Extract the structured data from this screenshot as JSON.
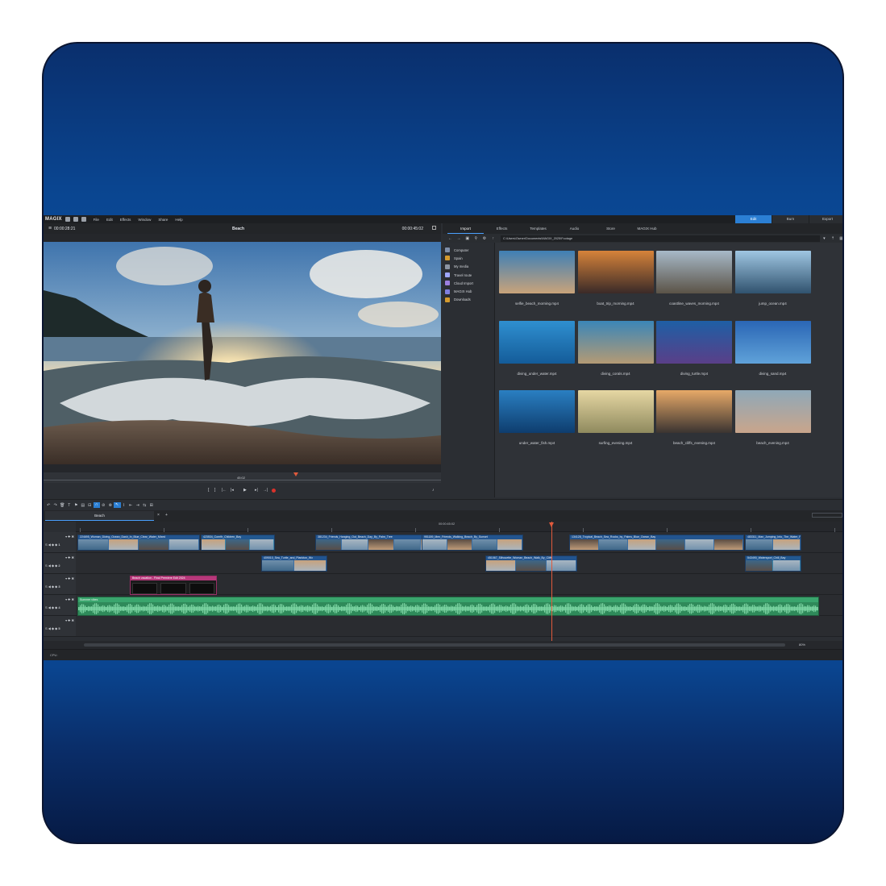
{
  "app": {
    "logo": "MAGIX",
    "menu": [
      "File",
      "Edit",
      "Effects",
      "Window",
      "Share",
      "Help"
    ],
    "modes": [
      "Edit",
      "Burn",
      "Export"
    ],
    "active_mode": "Edit"
  },
  "preview": {
    "timecode_left": "00:00:28:21",
    "title": "Beach",
    "timecode_right": "00:00:45:02",
    "scrub_timecode": "45:02"
  },
  "pool": {
    "tabs": [
      "Import",
      "Effects",
      "Templates",
      "Audio",
      "Store",
      "MAGIX Hub"
    ],
    "active_tab": "Import",
    "path": "C:\\Users\\Owner\\Documents\\MAGIX_2025\\Footage",
    "tree": [
      {
        "label": "Computer",
        "icon": "computer-icon",
        "color": "#7f8ea8"
      },
      {
        "label": "Spain",
        "icon": "folder-icon",
        "color": "#d49a2e"
      },
      {
        "label": "My media",
        "icon": "chevron-down-icon",
        "color": "#8c95a3"
      },
      {
        "label": "Travel route",
        "icon": "location-pin-icon",
        "color": "#9fa8ff"
      },
      {
        "label": "Cloud Import",
        "icon": "cloud-icon",
        "color": "#9c7fe0"
      },
      {
        "label": "MAGIX Hub",
        "icon": "hub-icon",
        "color": "#7f7fe0"
      },
      {
        "label": "Downloads",
        "icon": "downloads-icon",
        "color": "#d49a2e"
      }
    ],
    "files": [
      {
        "name": "selfie_beach_morning.mp4",
        "c1": "#3f7fb5",
        "c2": "#c9a37a"
      },
      {
        "name": "boat_trip_morning.mp4",
        "c1": "#d6833a",
        "c2": "#3a2a28"
      },
      {
        "name": "coastline_waves_morning.mp4",
        "c1": "#a7b9c8",
        "c2": "#5b5347"
      },
      {
        "name": "jump_ocean.mp4",
        "c1": "#9fc6e2",
        "c2": "#30526e"
      },
      {
        "name": "diving_under_water.mp4",
        "c1": "#2f8fd0",
        "c2": "#145c99"
      },
      {
        "name": "diving_corals.mp4",
        "c1": "#3b86b8",
        "c2": "#b49a74"
      },
      {
        "name": "diving_turtle.mp4",
        "c1": "#1e5fa5",
        "c2": "#5a3f88"
      },
      {
        "name": "diving_sand.mp4",
        "c1": "#2a66b5",
        "c2": "#5fa2d9"
      },
      {
        "name": "under_water_fish.mp4",
        "c1": "#2a7fc2",
        "c2": "#0e3d6e"
      },
      {
        "name": "surfing_evening.mp4",
        "c1": "#e6d7a3",
        "c2": "#8f8a5e"
      },
      {
        "name": "beach_cliffs_evening.mp4",
        "c1": "#e7a968",
        "c2": "#3b3431"
      },
      {
        "name": "beach_evening.mp4",
        "c1": "#8fa8b8",
        "c2": "#c9a58b"
      }
    ]
  },
  "timeline": {
    "tab": "Beach",
    "ruler_center": "00:00:45:02",
    "zoom": "80%",
    "cpu": "CPU:",
    "track_numbers": [
      "1",
      "2",
      "3",
      "4",
      "5"
    ],
    "track1": [
      {
        "label": "224695_Woman_Diving_Ocean_Dash_In_Blue_Clear_Water_Mixed",
        "color": "#3b6ea3"
      },
      {
        "label": "423534_Cornflr_Children_Bay",
        "color": "#3b85a8"
      },
      {
        "label": "381234_Friends_Hanging_Out_Beach_Day_By_Palm_Tree",
        "color": "#3b6ea3"
      },
      {
        "label": "951189_Men_Friends_Walking_Beach_By_Sunset",
        "color": "#3b6ea3"
      },
      {
        "label": "134128_Tropical_Beach_Sea_Rocks_by_Palms_Blue_Ocean_Bay",
        "color": "#3b6ea3"
      },
      {
        "label": "483311_Man_Jumping_Into_The_Water_From_a_Boat_at_Sunset_By",
        "color": "#3b6ea3"
      }
    ],
    "track2": [
      {
        "label": "409010_Sea_Turtle_and_Plankton_Wx",
        "color": "#3b6ea3"
      },
      {
        "label": "451067_Silhouette_Woman_Beach_Walk_By_Cliffs",
        "color": "#3b6ea3"
      },
      {
        "label": "543490_Watersport_Chill_Bay",
        "color": "#3b85a8"
      }
    ],
    "title_clip": "Beach vacation - Final Premiere Edit 2024",
    "audio_clip": "Summer vibes"
  }
}
